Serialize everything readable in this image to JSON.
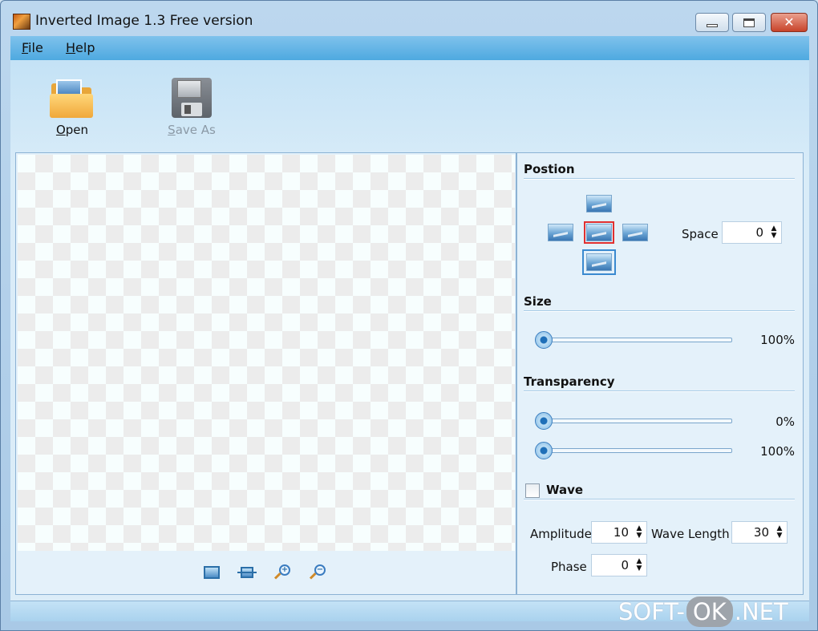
{
  "window": {
    "title": "Inverted Image 1.3 Free version",
    "close_glyph": "✕"
  },
  "menu": {
    "file": "File",
    "help": "Help"
  },
  "toolbar": {
    "open_label": "Open",
    "save_as_label": "Save As"
  },
  "panel": {
    "position": {
      "title": "Postion",
      "space_label": "Space",
      "space_value": "0"
    },
    "size": {
      "title": "Size",
      "value_label": "100%",
      "level": 1.0
    },
    "transparency": {
      "title": "Transparency",
      "from_label": "0%",
      "from_level": 0.0,
      "to_label": "100%",
      "to_level": 1.0
    },
    "wave": {
      "title": "Wave",
      "checked": false,
      "amplitude_label": "Amplitude",
      "amplitude_value": "10",
      "wave_length_label": "Wave Length",
      "wave_length_value": "30",
      "phase_label": "Phase",
      "phase_value": "0"
    }
  },
  "spin": {
    "up": "▲",
    "down": "▼"
  },
  "zoom": {
    "zoom_in_glyph": "+",
    "zoom_out_glyph": "−"
  },
  "watermark": {
    "prefix": "SOFT-",
    "middle": "OK",
    "suffix": ".NET"
  },
  "colors": {
    "menu_bar": "#4ea9e0",
    "selected_position_red": "#e03030",
    "selected_position_blue": "#3a8ad0"
  }
}
